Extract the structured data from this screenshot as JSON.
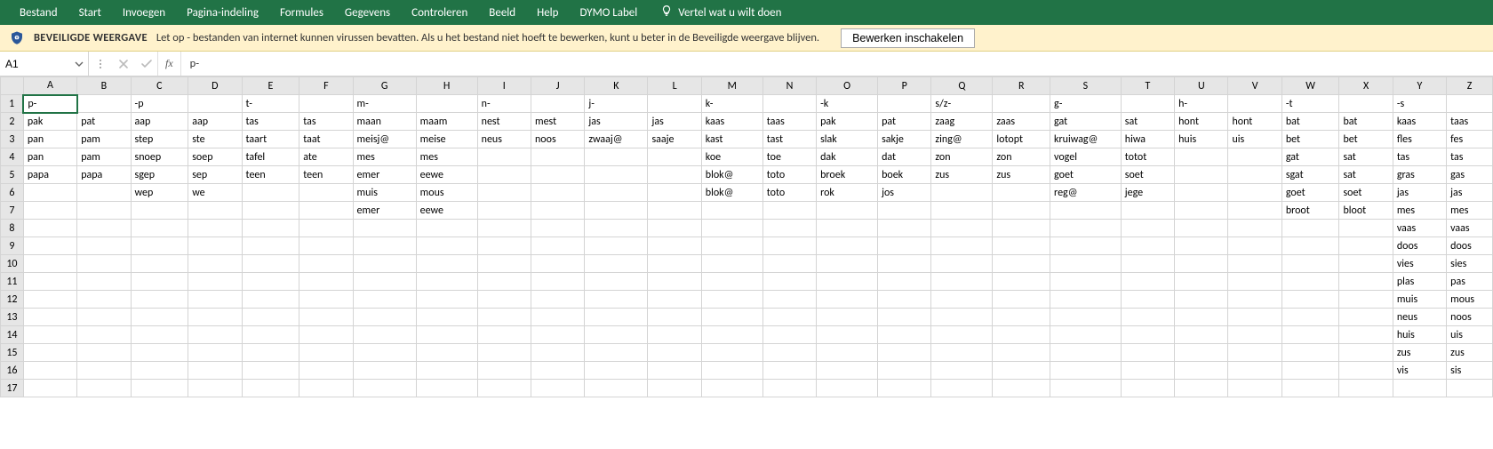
{
  "ribbon": {
    "tabs": [
      "Bestand",
      "Start",
      "Invoegen",
      "Pagina-indeling",
      "Formules",
      "Gegevens",
      "Controleren",
      "Beeld",
      "Help",
      "DYMO Label"
    ],
    "tell_me": "Vertel wat u wilt doen"
  },
  "protected_view": {
    "title": "BEVEILIGDE WEERGAVE",
    "message": "Let op - bestanden van internet kunnen virussen bevatten. Als u het bestand niet hoeft te bewerken, kunt u beter in de Beveiligde weergave blijven.",
    "button": "Bewerken inschakelen"
  },
  "formula_bar": {
    "name_box": "A1",
    "fx_label": "fx",
    "formula": "p-"
  },
  "columns": [
    "A",
    "B",
    "C",
    "D",
    "E",
    "F",
    "G",
    "H",
    "I",
    "J",
    "K",
    "L",
    "M",
    "N",
    "O",
    "P",
    "Q",
    "R",
    "S",
    "T",
    "U",
    "V",
    "W",
    "X",
    "Y",
    "Z"
  ],
  "row_count": 17,
  "active_cell": "A1",
  "cells": {
    "1": {
      "A": "p-",
      "C": "-p",
      "E": "t-",
      "G": "m-",
      "I": "n-",
      "K": "j-",
      "M": "k-",
      "O": "-k",
      "Q": "s/z-",
      "S": "g-",
      "U": "h-",
      "W": "-t",
      "Y": "-s"
    },
    "2": {
      "A": "pak",
      "B": "pat",
      "C": "aap",
      "D": "aap",
      "E": "tas",
      "F": "tas",
      "G": "maan",
      "H": "maam",
      "I": "nest",
      "J": "mest",
      "K": "jas",
      "L": "jas",
      "M": "kaas",
      "N": "taas",
      "O": "pak",
      "P": "pat",
      "Q": "zaag",
      "R": "zaas",
      "S": "gat",
      "T": "sat",
      "U": "hont",
      "V": "hont",
      "W": "bat",
      "X": "bat",
      "Y": "kaas",
      "Z": "taas"
    },
    "3": {
      "A": "pan",
      "B": "pam",
      "C": "step",
      "D": "ste",
      "E": "taart",
      "F": "taat",
      "G": "meisj@",
      "H": "meise",
      "I": "neus",
      "J": "noos",
      "K": "zwaaj@",
      "L": "saaje",
      "M": "kast",
      "N": "tast",
      "O": "slak",
      "P": "sakje",
      "Q": "zing@",
      "R": "lotopt",
      "S": "kruiwag@",
      "T": "hiwa",
      "U": "huis",
      "V": "uis",
      "W": "bet",
      "X": "bet",
      "Y": "fles",
      "Z": "fes"
    },
    "4": {
      "A": "pan",
      "B": "pam",
      "C": "snoep",
      "D": "soep",
      "E": "tafel",
      "F": "ate",
      "G": "mes",
      "H": "mes",
      "M": "koe",
      "N": "toe",
      "O": "dak",
      "P": "dat",
      "Q": "zon",
      "R": "zon",
      "S": "vogel",
      "T": "totot",
      "W": "gat",
      "X": "sat",
      "Y": "tas",
      "Z": "tas"
    },
    "5": {
      "A": "papa",
      "B": "papa",
      "C": "sgep",
      "D": "sep",
      "E": "teen",
      "F": "teen",
      "G": "emer",
      "H": "eewe",
      "M": "blok@",
      "N": "toto",
      "O": "broek",
      "P": "boek",
      "Q": "zus",
      "R": "zus",
      "S": "goet",
      "T": "soet",
      "W": "sgat",
      "X": "sat",
      "Y": "gras",
      "Z": "gas"
    },
    "6": {
      "C": "wep",
      "D": "we",
      "G": "muis",
      "H": "mous",
      "M": "blok@",
      "N": "toto",
      "O": "rok",
      "P": "jos",
      "S": "reg@",
      "T": "jege",
      "W": "goet",
      "X": "soet",
      "Y": "jas",
      "Z": "jas"
    },
    "7": {
      "G": "emer",
      "H": "eewe",
      "W": "broot",
      "X": "bloot",
      "Y": "mes",
      "Z": "mes"
    },
    "8": {
      "Y": "vaas",
      "Z": "vaas"
    },
    "9": {
      "Y": "doos",
      "Z": "doos"
    },
    "10": {
      "Y": "vies",
      "Z": "sies"
    },
    "11": {
      "Y": "plas",
      "Z": "pas"
    },
    "12": {
      "Y": "muis",
      "Z": "mous"
    },
    "13": {
      "Y": "neus",
      "Z": "noos"
    },
    "14": {
      "Y": "huis",
      "Z": "uis"
    },
    "15": {
      "Y": "zus",
      "Z": "zus"
    },
    "16": {
      "Y": "vis",
      "Z": "sis"
    }
  }
}
